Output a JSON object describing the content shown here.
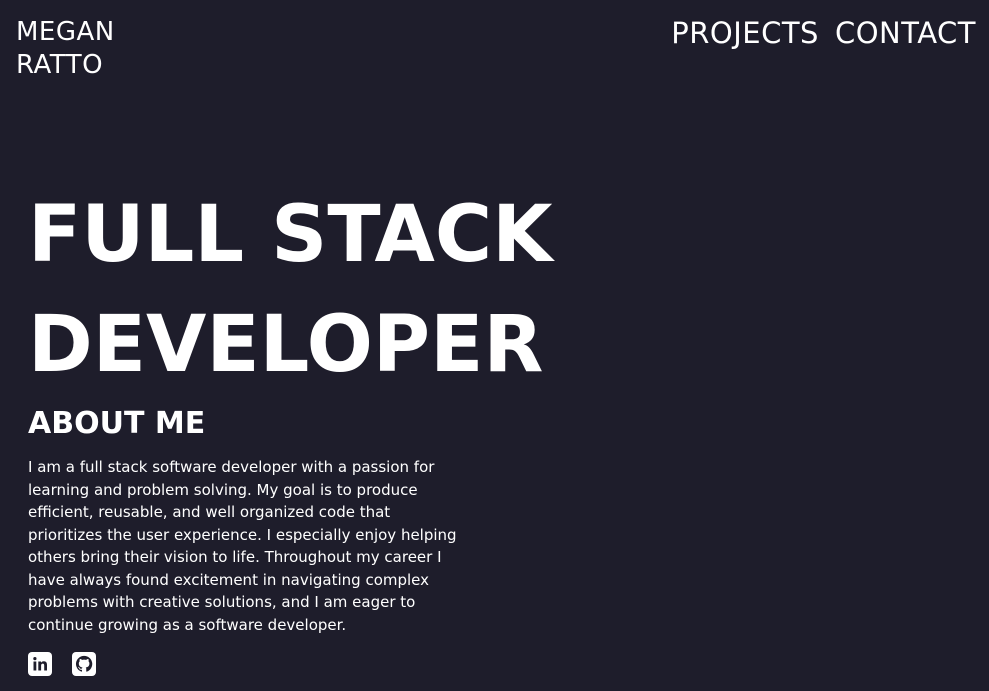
{
  "header": {
    "logo_line1": "MEGAN",
    "logo_line2": "RATTO",
    "nav": {
      "projects": "PROJECTS",
      "contact": "CONTACT"
    }
  },
  "hero": {
    "line1": "FULL STACK",
    "line2": "DEVELOPER"
  },
  "about": {
    "title": "ABOUT ME",
    "text": "I am a full stack software developer with a passion for learning and problem solving. My goal is to produce efficient, reusable, and well organized code that prioritizes the user experience. I especially enjoy helping others bring their vision to life. Throughout my career I have always found excitement in navigating complex problems with creative solutions, and I am eager to continue growing as a software developer."
  },
  "socials": [
    {
      "icon": "linkedin-icon"
    },
    {
      "icon": "github-icon"
    }
  ],
  "colors": {
    "background": "#1e1d2b",
    "text": "#ffffff"
  }
}
